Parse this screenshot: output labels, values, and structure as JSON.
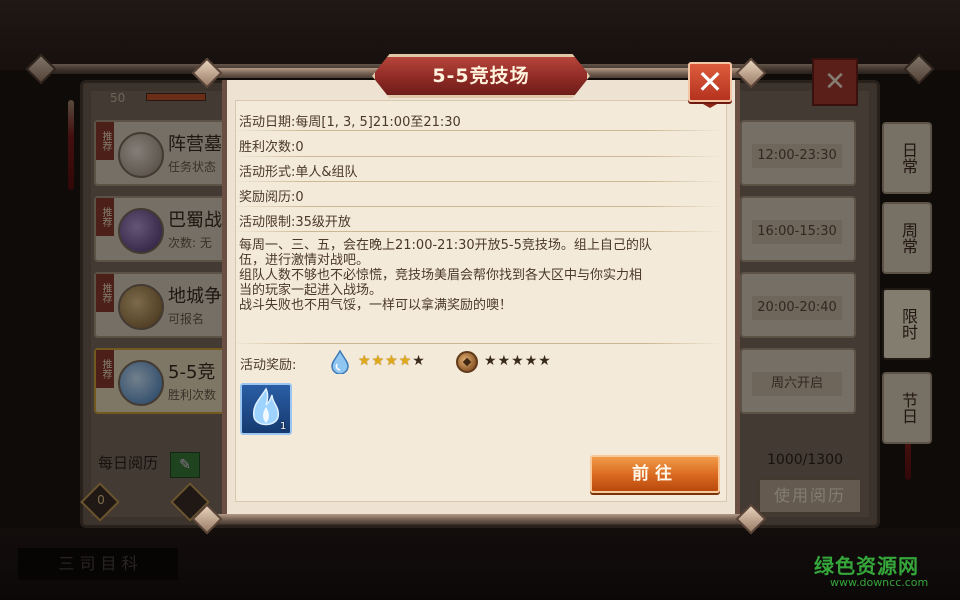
{
  "dialog": {
    "title": "5-5竞技场",
    "close_symbol": "✕",
    "info": [
      {
        "label": "活动日期:",
        "value": "每周[1, 3, 5]21:00至21:30"
      },
      {
        "label": "胜利次数:",
        "value": "0"
      },
      {
        "label": "活动形式:",
        "value": "单人&组队"
      },
      {
        "label": "奖励阅历:",
        "value": "0"
      },
      {
        "label": "活动限制:",
        "value": "35级开放"
      }
    ],
    "description": [
      "每周一、三、五，会在晚上21:00-21:30开放5-5竞技场。组上自己的队",
      "伍，进行激情对战吧。",
      "组队人数不够也不必惊慌，竞技场美眉会帮你找到各大区中与你实力相",
      "当的玩家一起进入战场。",
      "战斗失败也不用气馁，一样可以拿满奖励的噢！"
    ],
    "reward_label": "活动奖励:",
    "rewards": [
      {
        "icon": "water-drop-icon",
        "stars_filled": 4,
        "stars_total": 5
      },
      {
        "icon": "coin-icon",
        "stars_filled": 0,
        "stars_total": 5
      }
    ],
    "item": {
      "icon": "blue-flame-icon",
      "quantity": "1"
    },
    "go_button": "前往"
  },
  "background": {
    "level": "50",
    "rows": [
      {
        "badge": "推荐",
        "title": "阵营墓",
        "subtitle": "任务状态",
        "time": "12:00-23:30"
      },
      {
        "badge": "推荐",
        "title": "巴蜀战",
        "subtitle": "次数: 无",
        "time": "16:00-15:30"
      },
      {
        "badge": "推荐",
        "title": "地城争",
        "subtitle": "可报名",
        "time": "20:00-20:40"
      },
      {
        "badge": "推荐",
        "title": "5-5竞",
        "subtitle": "胜利次数",
        "time": "周六开启"
      }
    ],
    "side_tabs": [
      "日常",
      "周常",
      "限时",
      "节日"
    ],
    "active_tab": "限时",
    "daily_label": "每日阅历",
    "progress_text": "1000/1300",
    "use_button": "使用阅历",
    "progress_marker": "0",
    "bottom_caption": "三 司 目 科"
  },
  "watermark": {
    "title": "绿色资源网",
    "url": "www.downcc.com"
  },
  "colors": {
    "panel": "#f4ead9",
    "title_red": "#8f2a25",
    "close_red": "#d24a2f",
    "go_orange": "#d9681e",
    "star_gold": "#e0a91a",
    "watermark_green": "#35a63a"
  }
}
